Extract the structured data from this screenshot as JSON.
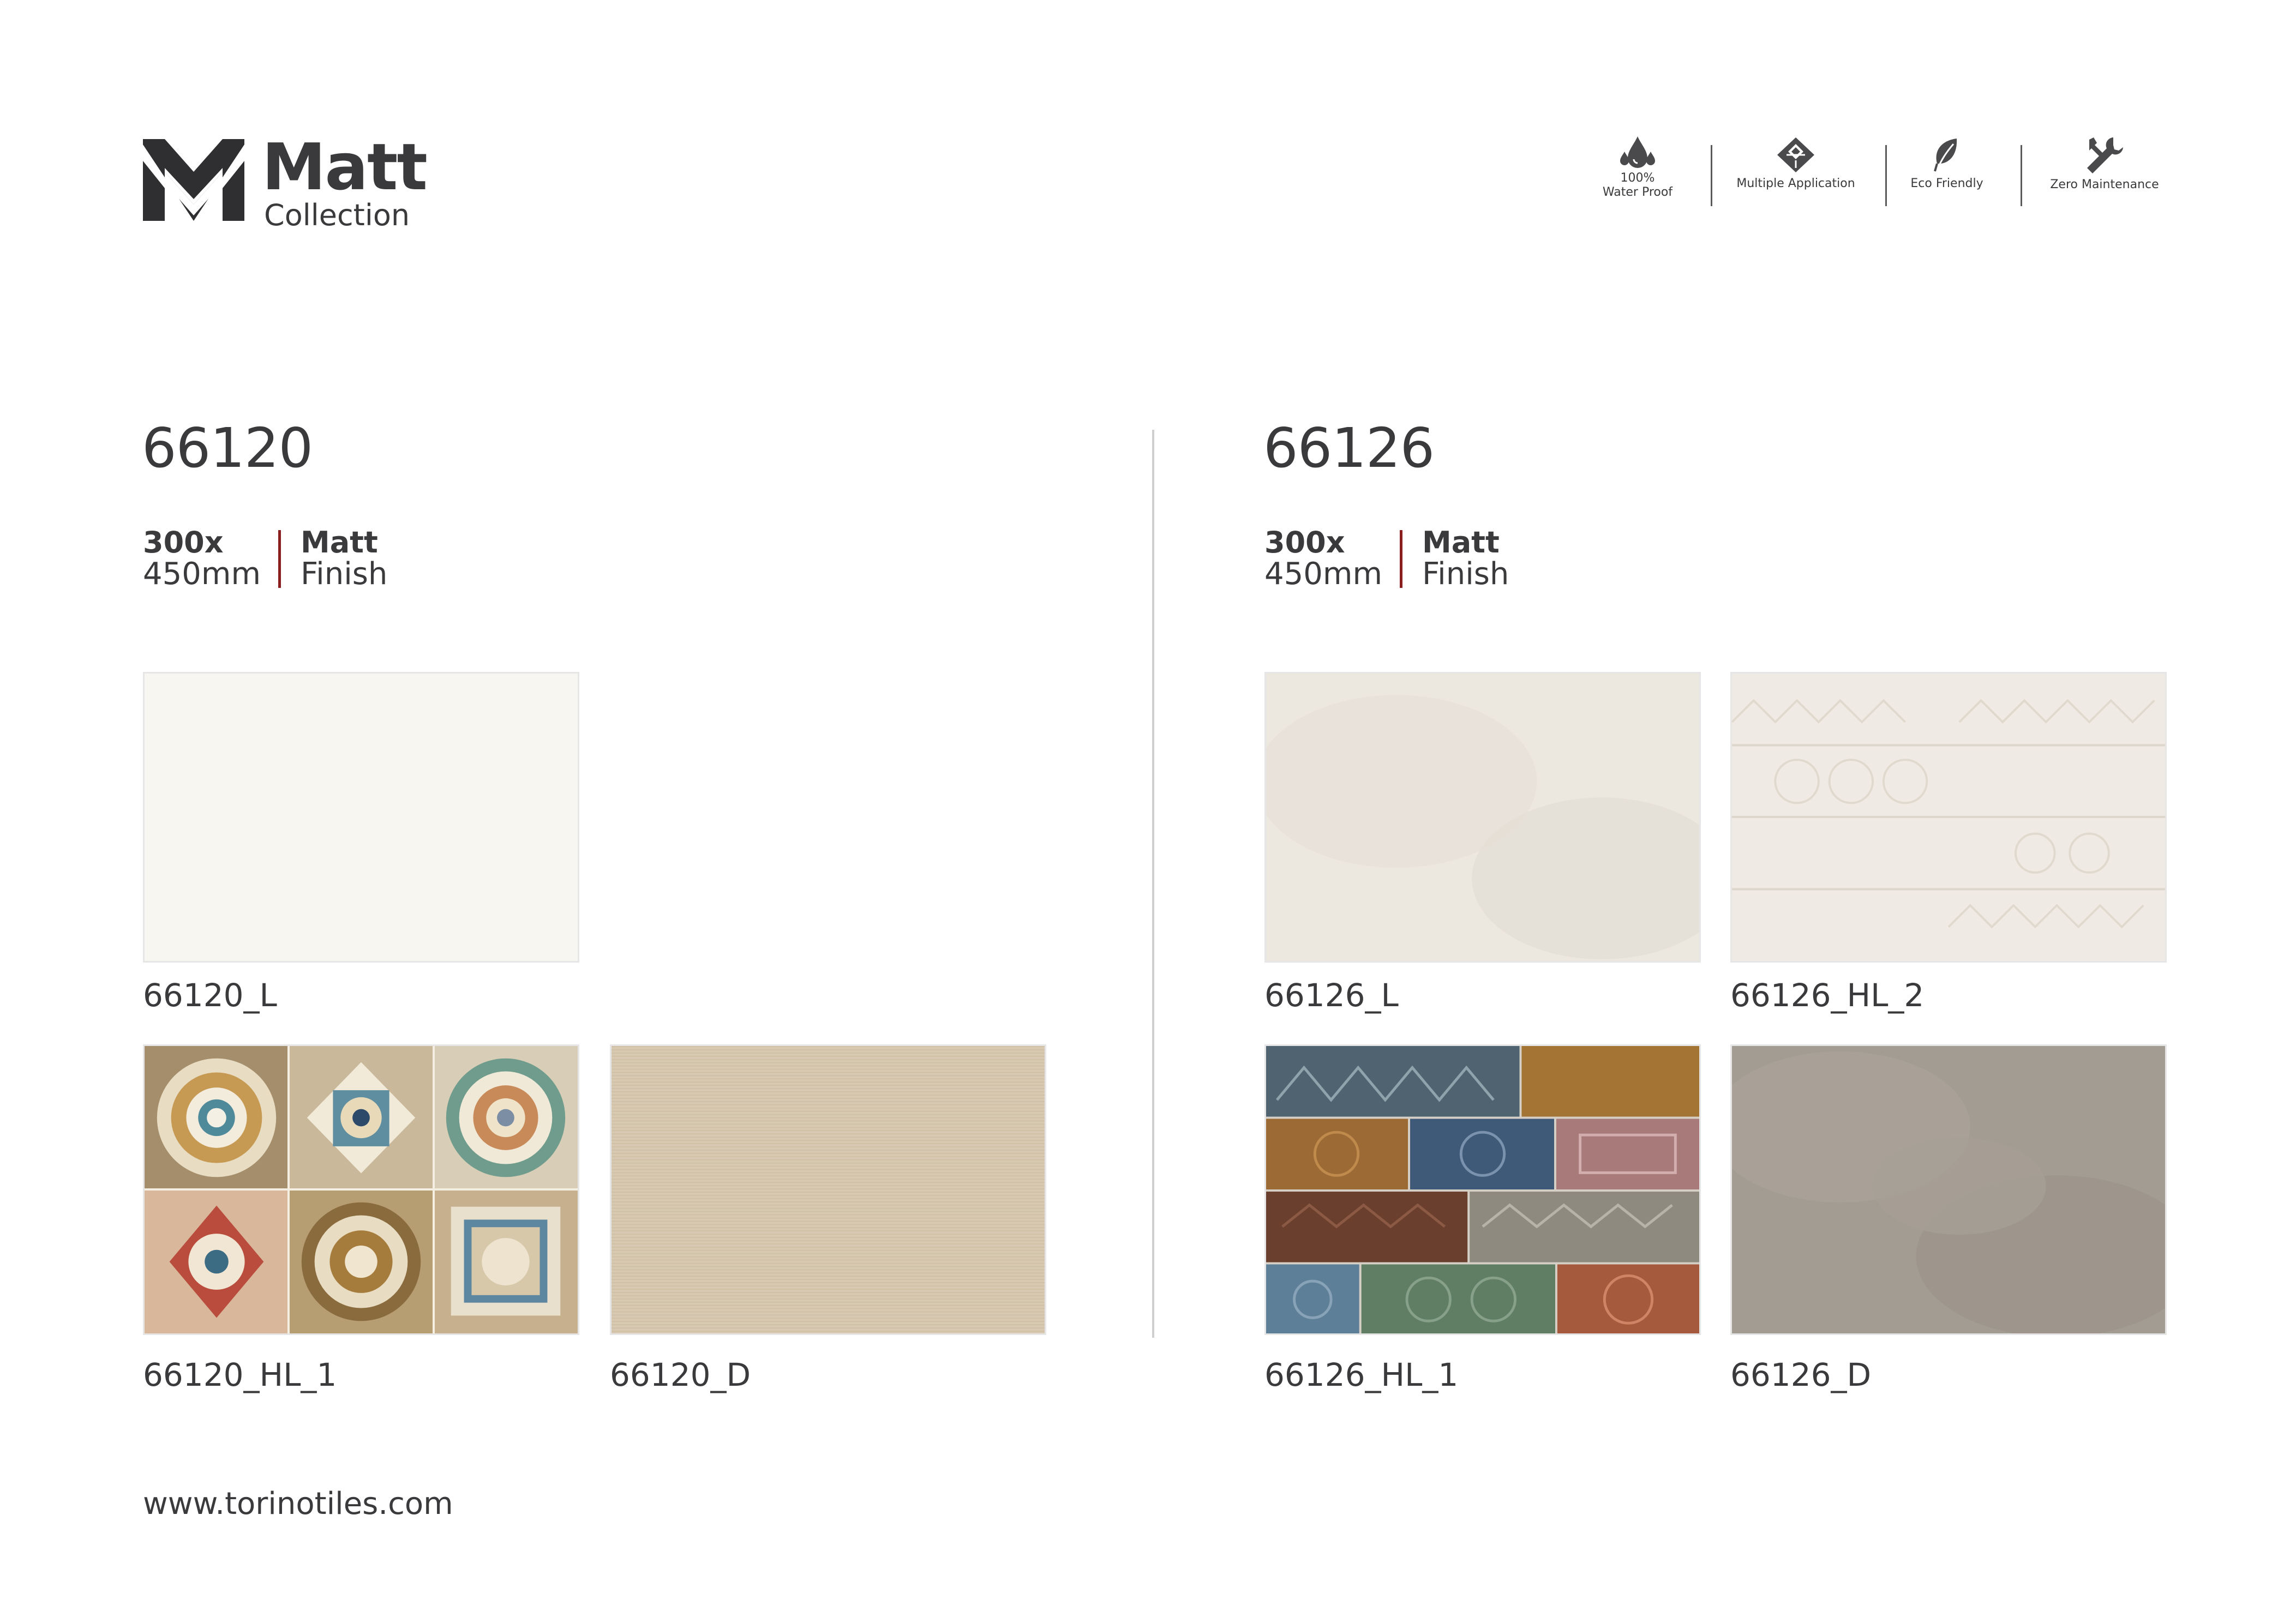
{
  "brand": {
    "title": "Matt",
    "subtitle": "Collection",
    "logo_icon": "double-chevron-logo"
  },
  "features": [
    {
      "icon": "water-drop-icon",
      "line1": "100%",
      "line2": "Water Proof"
    },
    {
      "icon": "tiles-diamond-icon",
      "line1": "",
      "line2": "Multiple Application"
    },
    {
      "icon": "leaf-icon",
      "line1": "",
      "line2": "Eco Friendly"
    },
    {
      "icon": "wrench-icon",
      "line1": "",
      "line2": "Zero Maintenance"
    }
  ],
  "products": [
    {
      "code": "66120",
      "size_line1": "300x",
      "size_line2": "450mm",
      "finish_line1": "Matt",
      "finish_line2": "Finish",
      "tiles": [
        {
          "label": "66120_L"
        },
        {
          "label": "66120_HL_1"
        },
        {
          "label": "66120_D"
        }
      ]
    },
    {
      "code": "66126",
      "size_line1": "300x",
      "size_line2": "450mm",
      "finish_line1": "Matt",
      "finish_line2": "Finish",
      "tiles": [
        {
          "label": "66126_L"
        },
        {
          "label": "66126_HL_2"
        },
        {
          "label": "66126_HL_1"
        },
        {
          "label": "66126_D"
        }
      ]
    }
  ],
  "website": "www.torinotiles.com",
  "colors": {
    "text": "#3a3a3c",
    "accent_divider": "#8b1e1e",
    "divider": "#cfcfcf"
  }
}
